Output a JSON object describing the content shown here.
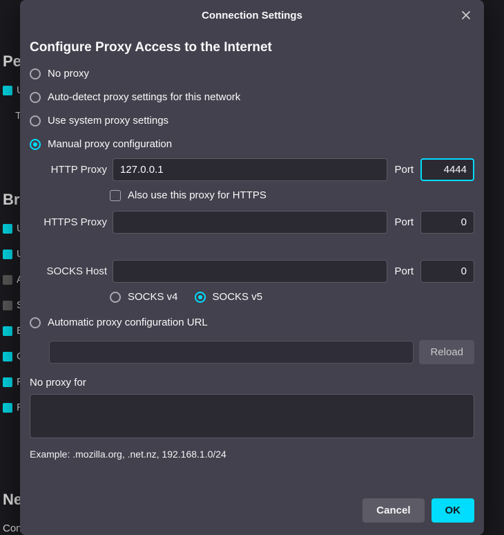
{
  "bg": {
    "performance_heading": "Per",
    "perf_u": "U",
    "perf_t": "T",
    "browsing_heading": "Bro",
    "items": [
      "U",
      "U",
      "A",
      "S",
      "E",
      "C",
      "R",
      "R"
    ],
    "network_heading": "Net",
    "conf": "Conf"
  },
  "titlebar": {
    "title": "Connection Settings"
  },
  "heading": "Configure Proxy Access to the Internet",
  "radio": {
    "no_proxy": "No proxy",
    "auto_detect": "Auto-detect proxy settings for this network",
    "system": "Use system proxy settings",
    "manual": "Manual proxy configuration",
    "auto_url": "Automatic proxy configuration URL"
  },
  "labels": {
    "http": "HTTP Proxy",
    "https": "HTTPS Proxy",
    "socks": "SOCKS Host",
    "port": "Port",
    "also_https": "Also use this proxy for HTTPS",
    "reload": "Reload",
    "no_proxy_for": "No proxy for",
    "example": "Example: .mozilla.org, .net.nz, 192.168.1.0/24",
    "socks4": "SOCKS v4",
    "socks5": "SOCKS v5"
  },
  "values": {
    "http_host": "127.0.0.1",
    "http_port": "4444",
    "https_host": "",
    "https_port": "0",
    "socks_host": "",
    "socks_port": "0",
    "pac_url": "",
    "no_proxy_for": ""
  },
  "state": {
    "selected_mode": "manual",
    "also_https": false,
    "socks_version": "v5"
  },
  "buttons": {
    "cancel": "Cancel",
    "ok": "OK"
  }
}
